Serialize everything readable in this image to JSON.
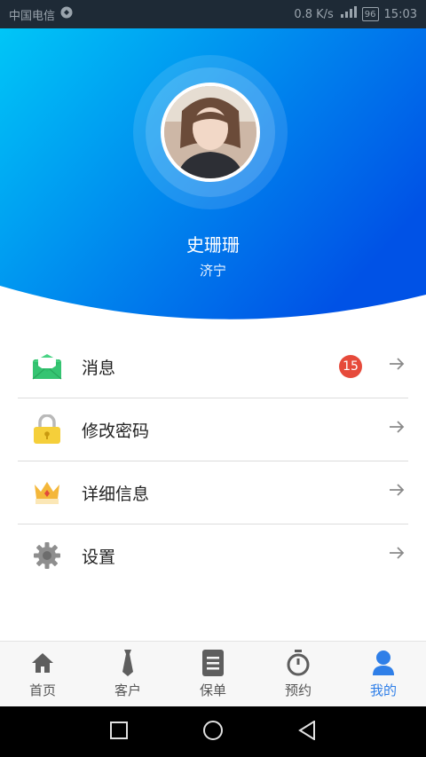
{
  "status_bar": {
    "carrier": "中国电信",
    "speed": "0.8 K/s",
    "battery": "96",
    "time": "15:03"
  },
  "profile": {
    "name": "史珊珊",
    "city": "济宁"
  },
  "menu": [
    {
      "label": "消息",
      "icon": "mail-icon",
      "badge": "15"
    },
    {
      "label": "修改密码",
      "icon": "lock-icon"
    },
    {
      "label": "详细信息",
      "icon": "crown-icon"
    },
    {
      "label": "设置",
      "icon": "gear-icon"
    }
  ],
  "tabs": [
    {
      "label": "首页",
      "icon": "home-icon"
    },
    {
      "label": "客户",
      "icon": "tie-icon"
    },
    {
      "label": "保单",
      "icon": "document-icon"
    },
    {
      "label": "预约",
      "icon": "stopwatch-icon"
    },
    {
      "label": "我的",
      "icon": "user-icon",
      "active": true
    }
  ],
  "colors": {
    "hero_start": "#00c6f7",
    "hero_end": "#0052e6",
    "active_tab": "#2f7fe8",
    "badge": "#e64a3b"
  }
}
